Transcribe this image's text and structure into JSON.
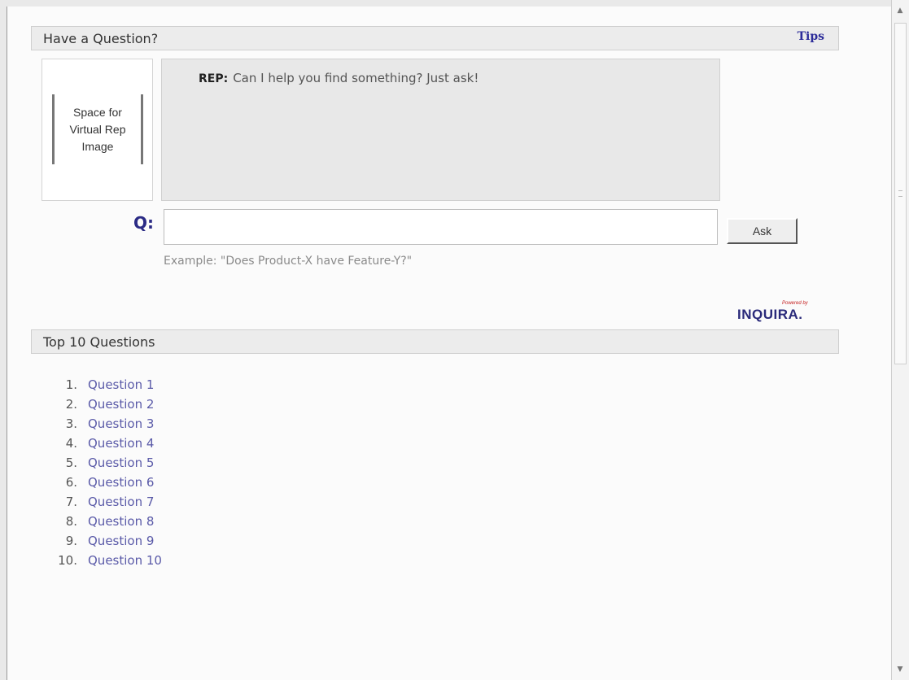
{
  "question_section": {
    "title": "Have a Question?",
    "tips_label": "Tips"
  },
  "rep_image": {
    "placeholder_text": "Space for\nVirtual Rep\nImage"
  },
  "chat": {
    "rep_label": "REP:",
    "rep_message": "Can I help you find something? Just ask!"
  },
  "ask": {
    "q_label": "Q:",
    "input_value": "",
    "button_label": "Ask",
    "example": "Example: \"Does Product-X have Feature-Y?\""
  },
  "logo": {
    "tagline": "Powered by",
    "wordmark": "INQUIRA."
  },
  "top_questions": {
    "title": "Top 10 Questions",
    "items": [
      {
        "num": "1.",
        "label": "Question 1"
      },
      {
        "num": "2.",
        "label": "Question 2"
      },
      {
        "num": "3.",
        "label": "Question 3"
      },
      {
        "num": "4.",
        "label": "Question 4"
      },
      {
        "num": "5.",
        "label": "Question 5"
      },
      {
        "num": "6.",
        "label": "Question 6"
      },
      {
        "num": "7.",
        "label": "Question 7"
      },
      {
        "num": "8.",
        "label": "Question 8"
      },
      {
        "num": "9.",
        "label": "Question 9"
      },
      {
        "num": "10.",
        "label": "Question 10"
      }
    ]
  },
  "colors": {
    "accent": "#2b2b85",
    "link": "#5a5aa8",
    "panel_bg": "#e8e8e8"
  }
}
